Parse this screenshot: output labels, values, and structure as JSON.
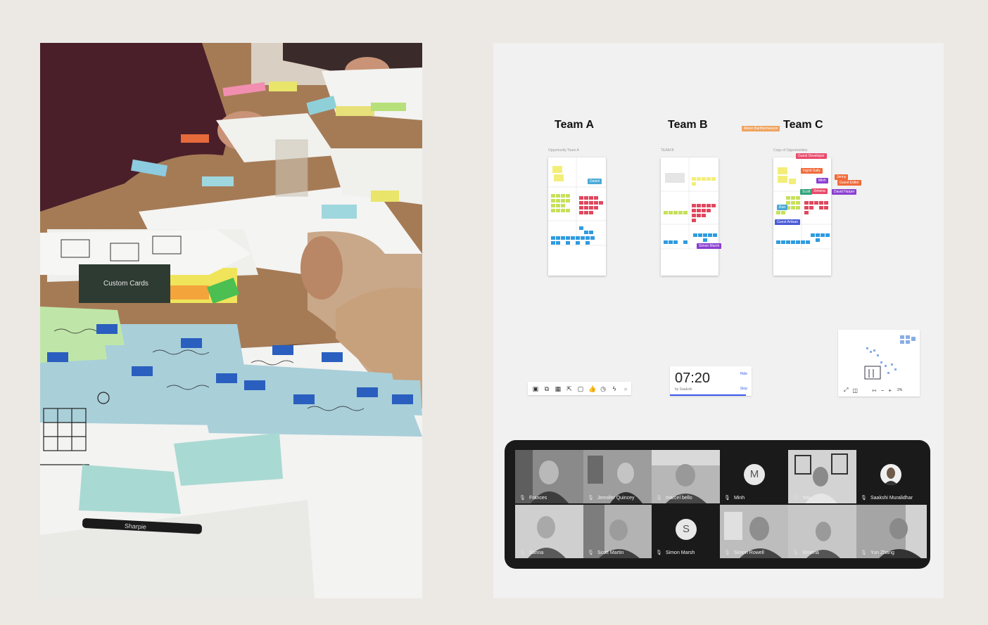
{
  "canvas": {
    "teams": [
      {
        "title": "Team A",
        "frame_label": "Opportunity Team A"
      },
      {
        "title": "Team B",
        "frame_label": "TEAM B"
      },
      {
        "title": "Team C",
        "frame_label": "Copy of Opportunities"
      }
    ],
    "cursors": [
      {
        "label": "Alison Barthlemesson",
        "color": "#f0a35e"
      },
      {
        "label": "Guest Developer",
        "color": "#e84a6b"
      },
      {
        "label": "Daniel",
        "color": "#4aa9d6"
      },
      {
        "label": "Ingrid Sally",
        "color": "#f06a3a"
      },
      {
        "label": "Minh",
        "color": "#8a3fd1"
      },
      {
        "label": "Jenny",
        "color": "#f06a3a"
      },
      {
        "label": "Guest Editor",
        "color": "#f06a3a"
      },
      {
        "label": "Scott",
        "color": "#2fa37a"
      },
      {
        "label": "Ximena",
        "color": "#e84a6b"
      },
      {
        "label": "David Harper",
        "color": "#8a3fd1"
      },
      {
        "label": "Run",
        "color": "#4aa9d6"
      },
      {
        "label": "Guest Artisan",
        "color": "#4a5ad6"
      },
      {
        "label": "Simon Marsh",
        "color": "#8a3fd1"
      }
    ],
    "toolbar_icons": [
      "template-icon",
      "frames-icon",
      "qr-icon",
      "share-icon",
      "chat-icon",
      "like-icon",
      "timer-icon",
      "lightning-icon",
      "more-icon"
    ],
    "timer": {
      "time": "07:20",
      "by": "by Saakshi",
      "hide": "Hide",
      "stop": "Stop"
    },
    "minimap": {
      "zoom": "2%"
    }
  },
  "video_call": {
    "participants": [
      {
        "name": "Frances"
      },
      {
        "name": "Jennifer Quincey"
      },
      {
        "name": "marcel bello"
      },
      {
        "name": "Minh",
        "initial": "M"
      },
      {
        "name": "You"
      },
      {
        "name": "Saakshi Muralidhar"
      },
      {
        "name": "Sanna"
      },
      {
        "name": "Scott Martin"
      },
      {
        "name": "Simon Marsh",
        "initial": "S"
      },
      {
        "name": "Simon Rowell"
      },
      {
        "name": "Ximena"
      },
      {
        "name": "Yun Zhang"
      }
    ]
  }
}
